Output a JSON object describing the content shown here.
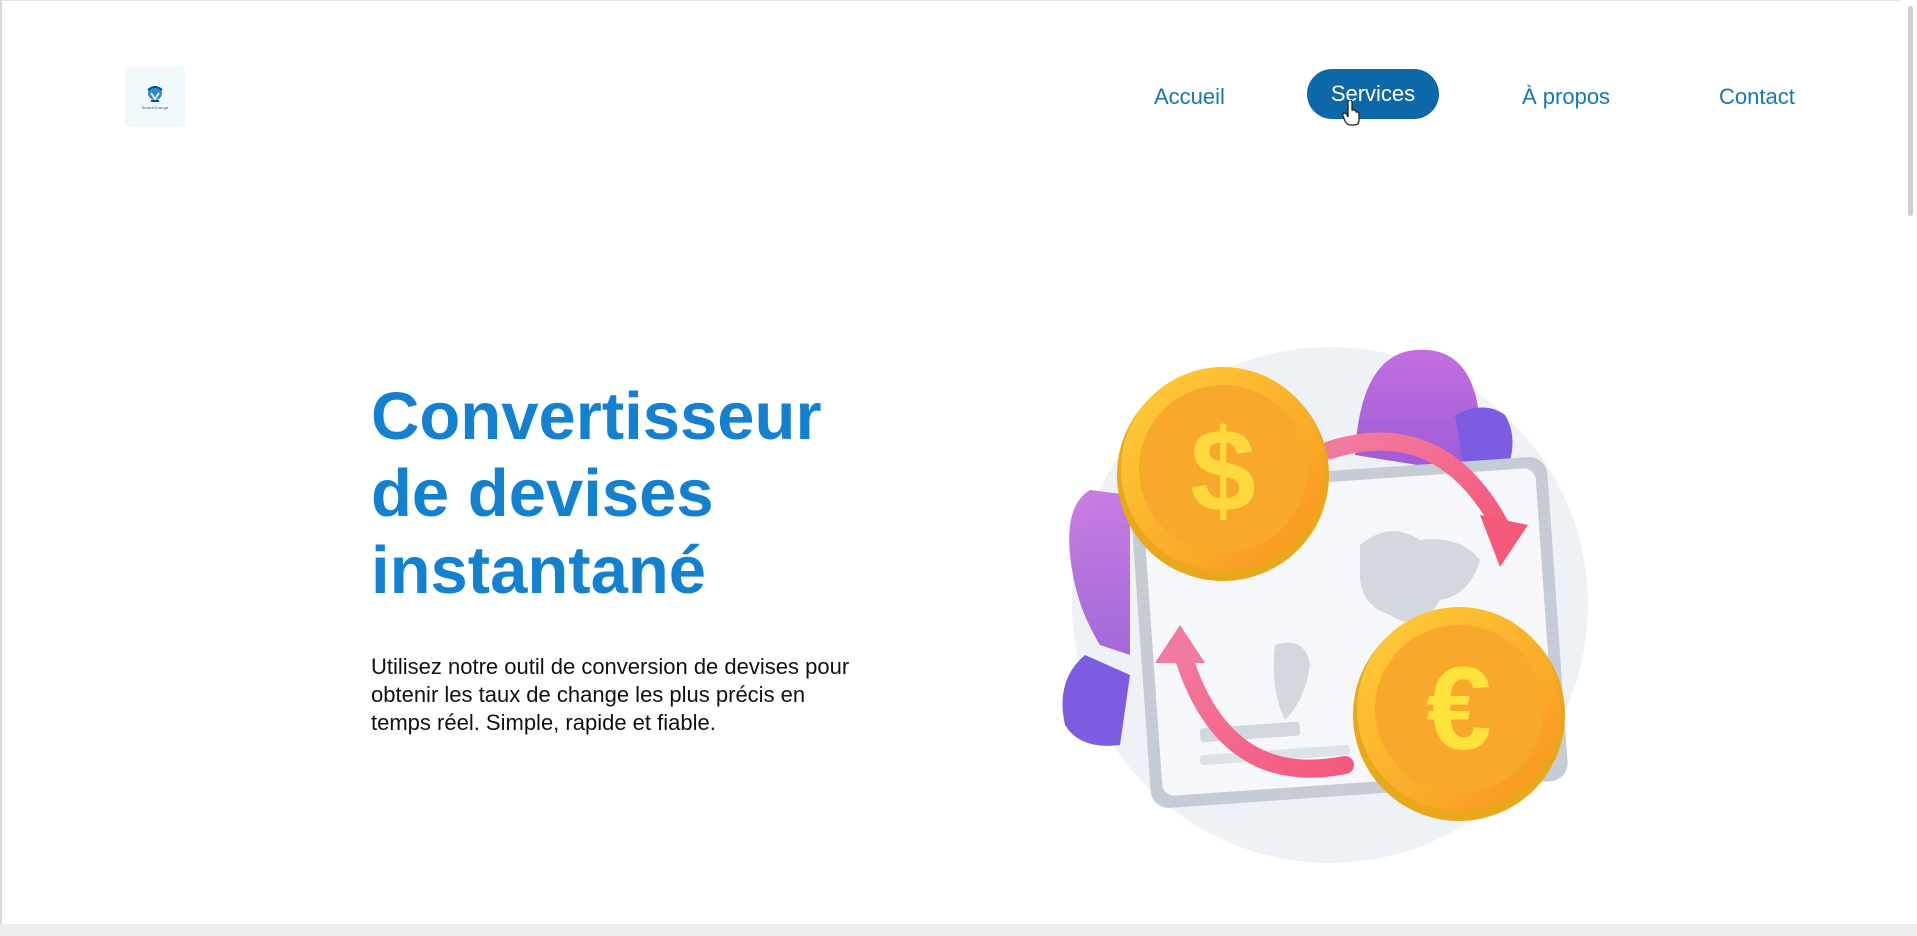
{
  "header": {
    "logo_text": "SmartChange"
  },
  "nav": {
    "items": [
      {
        "label": "Accueil",
        "active": false
      },
      {
        "label": "Services",
        "active": true
      },
      {
        "label": "À propos",
        "active": false
      },
      {
        "label": "Contact",
        "active": false
      }
    ]
  },
  "hero": {
    "title_lines": [
      "Convertisseur",
      "de devises",
      "instantané"
    ],
    "description": "Utilisez notre outil de conversion de devises pour obtenir les taux de change les plus précis en temps réel. Simple, rapide et fiable."
  },
  "illustration": {
    "coin_symbols": [
      "$",
      "€"
    ],
    "icons": [
      "dollar-coin-icon",
      "euro-coin-icon",
      "world-map-icon",
      "exchange-arrow-icon"
    ]
  },
  "colors": {
    "accent": "#1381cf",
    "nav_active_bg": "#0c68a8",
    "nav_text": "#1578b6",
    "coin_gold": "#f6b12c",
    "arrow_pink": "#f06a8f",
    "leaf_purple": "#a55fd8"
  }
}
